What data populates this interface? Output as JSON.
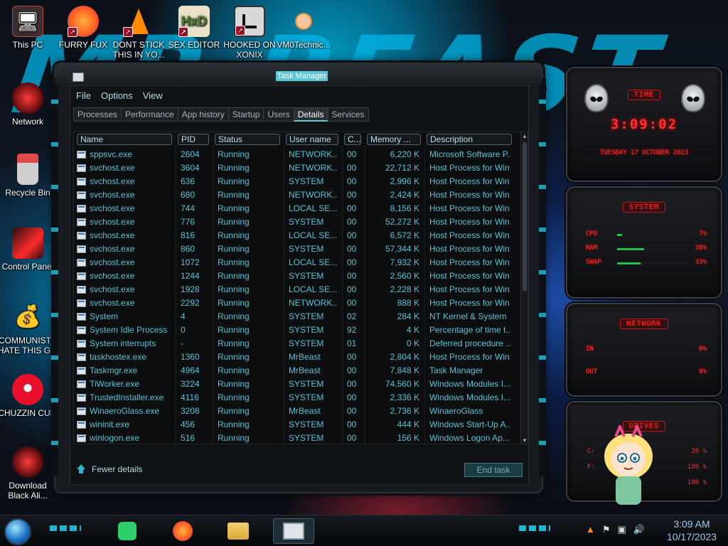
{
  "desktop": {
    "icons": [
      {
        "label": "This PC",
        "icon": "computer-icon"
      },
      {
        "label": "FURRY FUX",
        "icon": "firefox-icon"
      },
      {
        "label": "DONT STICK THIS IN YO...",
        "icon": "vlc-cone-icon"
      },
      {
        "label": "SEX EDITOR",
        "icon": "hxd-editor-icon"
      },
      {
        "label": "HOOKED ON XONIX",
        "icon": "xonix-game-icon"
      },
      {
        "label": "VM0Technic...",
        "icon": "doctor-icon"
      },
      {
        "label": "Network",
        "icon": "network-icon"
      },
      {
        "label": "Recycle Bin",
        "icon": "recycle-bin-icon"
      },
      {
        "label": "Control Panel",
        "icon": "control-panel-icon"
      },
      {
        "label": "COMMUNISTS HATE THIS G...",
        "icon": "money-bag-icon"
      },
      {
        "label": "CHUZZIN CUM",
        "icon": "red-fuzzball-icon"
      },
      {
        "label": "Download Black Ali...",
        "icon": "alien-orb-icon"
      }
    ]
  },
  "task_manager": {
    "title": "Task Manager",
    "menu": [
      "File",
      "Options",
      "View"
    ],
    "tabs": [
      "Processes",
      "Performance",
      "App history",
      "Startup",
      "Users",
      "Details",
      "Services"
    ],
    "active_tab": "Details",
    "columns": [
      "Name",
      "PID",
      "Status",
      "User name",
      "C...",
      "Memory ...",
      "Description"
    ],
    "rows": [
      [
        "sppsvc.exe",
        "2604",
        "Running",
        "NETWORK...",
        "00",
        "6,220 K",
        "Microsoft Software P..."
      ],
      [
        "svchost.exe",
        "3604",
        "Running",
        "NETWORK...",
        "00",
        "22,712 K",
        "Host Process for Win..."
      ],
      [
        "svchost.exe",
        "636",
        "Running",
        "SYSTEM",
        "00",
        "2,996 K",
        "Host Process for Win..."
      ],
      [
        "svchost.exe",
        "680",
        "Running",
        "NETWORK...",
        "00",
        "2,424 K",
        "Host Process for Win..."
      ],
      [
        "svchost.exe",
        "744",
        "Running",
        "LOCAL SE...",
        "00",
        "8,156 K",
        "Host Process for Win..."
      ],
      [
        "svchost.exe",
        "776",
        "Running",
        "SYSTEM",
        "00",
        "52,272 K",
        "Host Process for Win..."
      ],
      [
        "svchost.exe",
        "816",
        "Running",
        "LOCAL SE...",
        "00",
        "6,572 K",
        "Host Process for Win..."
      ],
      [
        "svchost.exe",
        "860",
        "Running",
        "SYSTEM",
        "00",
        "57,344 K",
        "Host Process for Win..."
      ],
      [
        "svchost.exe",
        "1072",
        "Running",
        "LOCAL SE...",
        "00",
        "7,932 K",
        "Host Process for Win..."
      ],
      [
        "svchost.exe",
        "1244",
        "Running",
        "SYSTEM",
        "00",
        "2,560 K",
        "Host Process for Win..."
      ],
      [
        "svchost.exe",
        "1928",
        "Running",
        "LOCAL SE...",
        "00",
        "2,228 K",
        "Host Process for Win..."
      ],
      [
        "svchost.exe",
        "2292",
        "Running",
        "NETWORK...",
        "00",
        "888 K",
        "Host Process for Win..."
      ],
      [
        "System",
        "4",
        "Running",
        "SYSTEM",
        "02",
        "284 K",
        "NT Kernel & System"
      ],
      [
        "System Idle Process",
        "0",
        "Running",
        "SYSTEM",
        "92",
        "4 K",
        "Percentage of time t..."
      ],
      [
        "System interrupts",
        "-",
        "Running",
        "SYSTEM",
        "01",
        "0 K",
        "Deferred procedure ..."
      ],
      [
        "taskhostex.exe",
        "1360",
        "Running",
        "MrBeast",
        "00",
        "2,804 K",
        "Host Process for Win..."
      ],
      [
        "Taskmgr.exe",
        "4964",
        "Running",
        "MrBeast",
        "00",
        "7,848 K",
        "Task Manager"
      ],
      [
        "TiWorker.exe",
        "3224",
        "Running",
        "SYSTEM",
        "00",
        "74,560 K",
        "Windows Modules I..."
      ],
      [
        "TrustedInstaller.exe",
        "4116",
        "Running",
        "SYSTEM",
        "00",
        "2,336 K",
        "Windows Modules I..."
      ],
      [
        "WinaeroGlass.exe",
        "3208",
        "Running",
        "MrBeast",
        "00",
        "2,736 K",
        "WinaeroGlass"
      ],
      [
        "wininit.exe",
        "456",
        "Running",
        "SYSTEM",
        "00",
        "444 K",
        "Windows Start-Up A..."
      ],
      [
        "winlogon.exe",
        "516",
        "Running",
        "SYSTEM",
        "00",
        "156 K",
        "Windows Logon Ap..."
      ]
    ],
    "fewer_details": "Fewer details",
    "end_task": "End task"
  },
  "gadgets": {
    "time": {
      "title": "TIME",
      "clock": "3:09:02",
      "date": "TUESDAY 17 OCTOBER 2023"
    },
    "system": {
      "title": "SYSTEM",
      "rows": [
        {
          "label": "CPU",
          "value": "7%",
          "fraction": 0.07
        },
        {
          "label": "RAM",
          "value": "38%",
          "fraction": 0.38
        },
        {
          "label": "SWAP",
          "value": "33%",
          "fraction": 0.33
        }
      ]
    },
    "network": {
      "title": "NETWORK",
      "rows": [
        {
          "label": "IN",
          "value": "0%"
        },
        {
          "label": "OUT",
          "value": "0%"
        }
      ]
    },
    "drives": {
      "title": "DRIVES",
      "rows": [
        {
          "label": "C:",
          "value": "28 %"
        },
        {
          "label": "F:",
          "value": "100 %"
        },
        {
          "label": "",
          "value": "100 %"
        }
      ]
    }
  },
  "taskbar": {
    "apps": [
      "notepad-green-icon",
      "firefox-icon",
      "file-explorer-icon",
      "task-manager-icon"
    ],
    "tray_icons": [
      "flag-icon",
      "network-icon",
      "volume-icon"
    ],
    "time": "3:09 AM",
    "date": "10/17/2023"
  },
  "colors": {
    "accent": "#5cc7d6",
    "row_text": "#56c4d8",
    "gadget_red": "#ff3030"
  }
}
